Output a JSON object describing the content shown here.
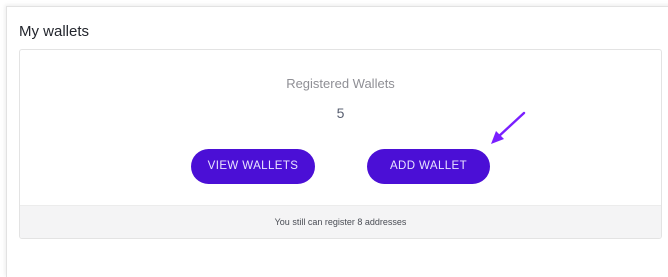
{
  "section": {
    "title": "My wallets"
  },
  "wallets_card": {
    "label": "Registered Wallets",
    "count": "5",
    "view_button_label": "VIEW WALLETS",
    "add_button_label": "ADD WALLET",
    "footer_text": "You still can register 8 addresses"
  },
  "annotation": {
    "icon": "arrow-icon",
    "color": "#7a1fff"
  },
  "colors": {
    "button_bg": "#4b0fd6",
    "button_text": "#e9e4ff"
  }
}
